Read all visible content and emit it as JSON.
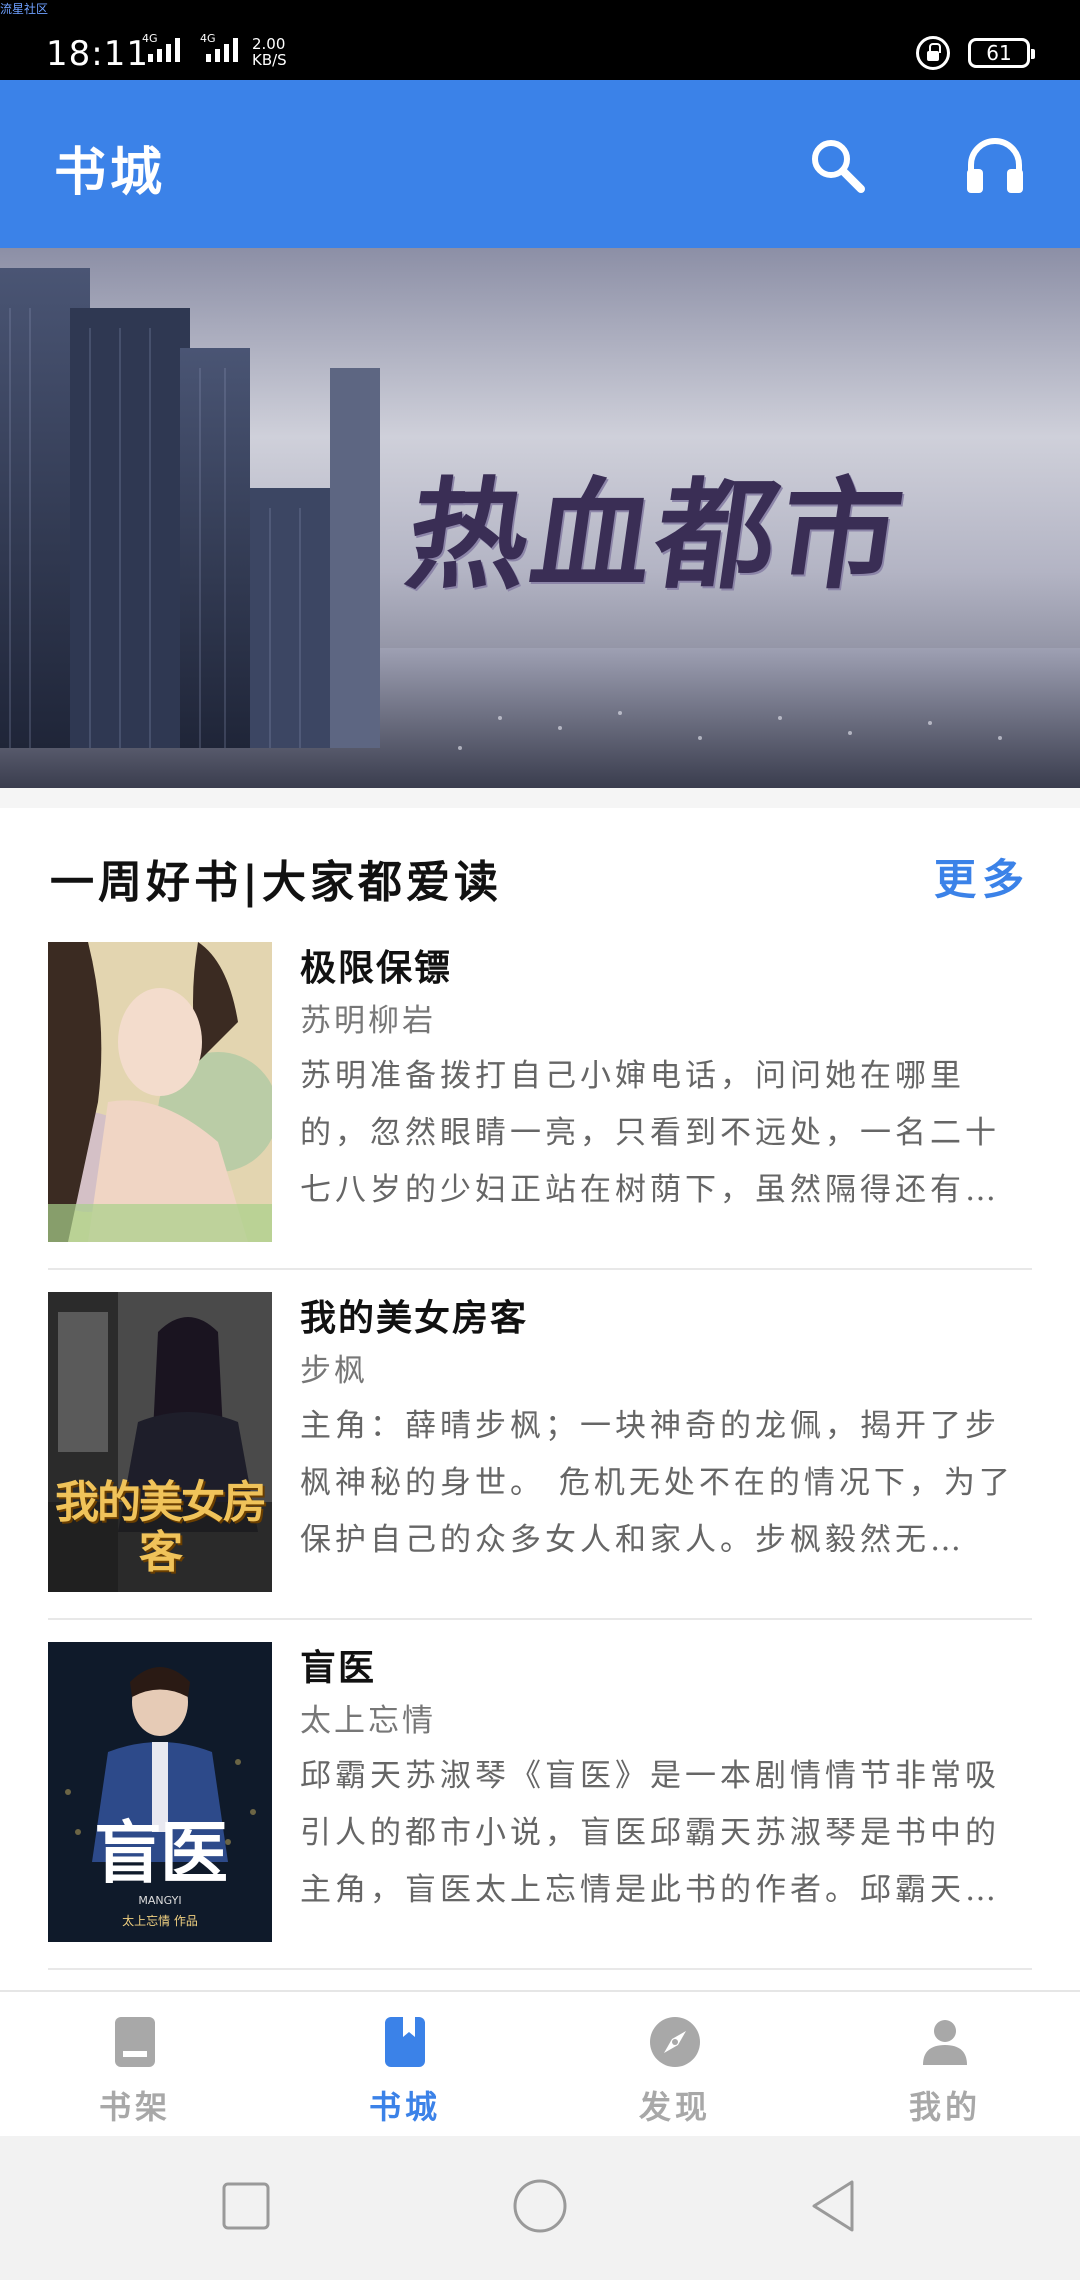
{
  "status": {
    "watermark": "流星社区",
    "time": "18:11",
    "network1": "4G",
    "network2": "4G",
    "speed_value": "2.00",
    "speed_unit": "KB/S",
    "battery": "61"
  },
  "app_bar": {
    "title": "书城"
  },
  "banner": {
    "title": "热血都市"
  },
  "section": {
    "title": "一周好书|大家都爱读",
    "more": "更多"
  },
  "books": [
    {
      "title": "极限保镖",
      "author": "苏明柳岩",
      "description": "苏明准备拨打自己小婶电话，问问她在哪里的，忽然眼睛一亮，只看到不远处，一名二十七八岁的少妇正站在树荫下，虽然隔得还有…"
    },
    {
      "title": "我的美女房客",
      "author": "步枫",
      "description": "主角：薛晴步枫；一块神奇的龙佩，揭开了步枫神秘的身世。 危机无处不在的情况下，为了保护自己的众多女人和家人。步枫毅然无…",
      "cover_text": "我的美女房客"
    },
    {
      "title": "盲医",
      "author": "太上忘情",
      "description": "邱霸天苏淑琴《盲医》是一本剧情情节非常吸引人的都市小说，盲医邱霸天苏淑琴是书中的主角，盲医太上忘情是此书的作者。邱霸天…",
      "cover_text": "盲医",
      "cover_sub": "MANGYI",
      "cover_author": "太上忘情 作品"
    }
  ],
  "bottom_nav": [
    {
      "label": "书架",
      "icon": "bookshelf-icon",
      "active": false
    },
    {
      "label": "书城",
      "icon": "bookstore-icon",
      "active": true
    },
    {
      "label": "发现",
      "icon": "compass-icon",
      "active": false
    },
    {
      "label": "我的",
      "icon": "person-icon",
      "active": false
    }
  ],
  "colors": {
    "primary": "#3b82e8",
    "inactive": "#a8a8a8"
  }
}
